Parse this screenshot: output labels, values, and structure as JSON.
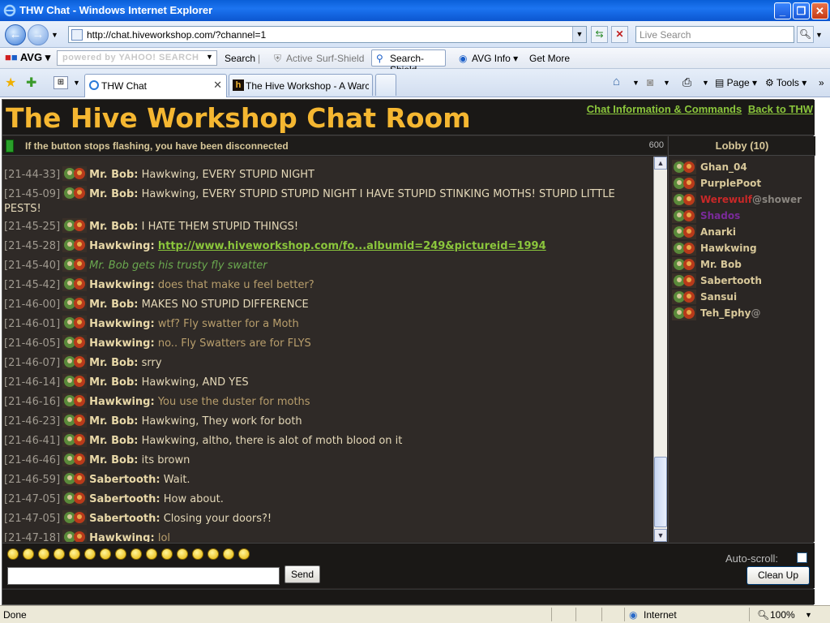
{
  "window": {
    "title": "THW Chat - Windows Internet Explorer"
  },
  "addressbar": {
    "url": "http://chat.hiveworkshop.com/?channel=1",
    "search_placeholder": "Live Search"
  },
  "avg": {
    "logo": "AVG",
    "yahoo_text": "powered by YAHOO! SEARCH",
    "search_label": "Search",
    "active_label": "Active",
    "surf_label": "Surf-Shield",
    "shield_label": "Search-Shield",
    "info_label": "AVG Info",
    "getmore_label": "Get More"
  },
  "tabs": [
    {
      "label": "THW Chat"
    },
    {
      "label": "The Hive Workshop - A Warc..."
    }
  ],
  "commands": {
    "page_label": "Page",
    "tools_label": "Tools"
  },
  "chat": {
    "title": "The Hive Workshop Chat Room",
    "link_info": "Chat Information & Commands",
    "link_back": "Back to THW",
    "status_msg": "If the button stops flashing, you have been disconnected",
    "count": "600",
    "messages": [
      {
        "ts": "[21-44-33]",
        "nick": "Mr. Bob:",
        "text": "Hawkwing, EVERY STUPID NIGHT",
        "style": "txt"
      },
      {
        "ts": "[21-45-09]",
        "nick": "Mr. Bob:",
        "text": "Hawkwing, EVERY STUPID STUPID NIGHT I HAVE STUPID STINKING MOTHS! STUPID LITTLE PESTS!",
        "style": "txt"
      },
      {
        "ts": "[21-45-25]",
        "nick": "Mr. Bob:",
        "text": "I HATE THEM STUPID THINGS!",
        "style": "txt"
      },
      {
        "ts": "[21-45-28]",
        "nick": "Hawkwing:",
        "text": "http://www.hiveworkshop.com/fo...albumid=249&pictureid=1994",
        "style": "link"
      },
      {
        "ts": "[21-45-40]",
        "nick": "",
        "text": "Mr. Bob gets his trusty fly swatter",
        "style": "emote"
      },
      {
        "ts": "[21-45-42]",
        "nick": "Hawkwing:",
        "text": "does that make u feel better?",
        "style": "alt"
      },
      {
        "ts": "[21-46-00]",
        "nick": "Mr. Bob:",
        "text": "MAKES NO STUPID DIFFERENCE",
        "style": "txt"
      },
      {
        "ts": "[21-46-01]",
        "nick": "Hawkwing:",
        "text": "wtf? Fly swatter for a Moth",
        "style": "alt"
      },
      {
        "ts": "[21-46-05]",
        "nick": "Hawkwing:",
        "text": "no.. Fly Swatters are for FLYS",
        "style": "alt"
      },
      {
        "ts": "[21-46-07]",
        "nick": "Mr. Bob:",
        "text": "srry",
        "style": "txt"
      },
      {
        "ts": "[21-46-14]",
        "nick": "Mr. Bob:",
        "text": "Hawkwing, AND YES",
        "style": "txt"
      },
      {
        "ts": "[21-46-16]",
        "nick": "Hawkwing:",
        "text": "You use the duster for moths",
        "style": "alt"
      },
      {
        "ts": "[21-46-23]",
        "nick": "Mr. Bob:",
        "text": "Hawkwing, They work for both",
        "style": "txt"
      },
      {
        "ts": "[21-46-41]",
        "nick": "Mr. Bob:",
        "text": "Hawkwing, altho, there is alot of moth blood on it",
        "style": "txt"
      },
      {
        "ts": "[21-46-46]",
        "nick": "Mr. Bob:",
        "text": "its brown",
        "style": "txt"
      },
      {
        "ts": "[21-46-59]",
        "nick": "Sabertooth:",
        "text": "Wait.",
        "style": "txt"
      },
      {
        "ts": "[21-47-05]",
        "nick": "Sabertooth:",
        "text": "How about.",
        "style": "txt"
      },
      {
        "ts": "[21-47-05]",
        "nick": "Sabertooth:",
        "text": "Closing your doors?!",
        "style": "txt"
      },
      {
        "ts": "[21-47-18]",
        "nick": "Hawkwing:",
        "text": "lol",
        "style": "alt"
      }
    ],
    "lobby_title": "Lobby (10)",
    "users": [
      {
        "name": "Ghan_04",
        "suffix": "",
        "style": ""
      },
      {
        "name": "PurplePoot",
        "suffix": "",
        "style": ""
      },
      {
        "name": "Werewulf",
        "suffix": "@shower",
        "style": "away"
      },
      {
        "name": "Shados",
        "suffix": "",
        "style": "purple"
      },
      {
        "name": "Anarki",
        "suffix": "",
        "style": ""
      },
      {
        "name": "Hawkwing",
        "suffix": "",
        "style": ""
      },
      {
        "name": "Mr. Bob",
        "suffix": "",
        "style": ""
      },
      {
        "name": "Sabertooth",
        "suffix": "",
        "style": ""
      },
      {
        "name": "Sansui",
        "suffix": "",
        "style": ""
      },
      {
        "name": "Teh_Ephy",
        "suffix": "@",
        "style": ""
      }
    ],
    "send_label": "Send",
    "autoscroll_label": "Auto-scroll:",
    "cleanup_label": "Clean Up"
  },
  "statusbar": {
    "left": "Done",
    "zone": "Internet",
    "zoom": "100%"
  }
}
